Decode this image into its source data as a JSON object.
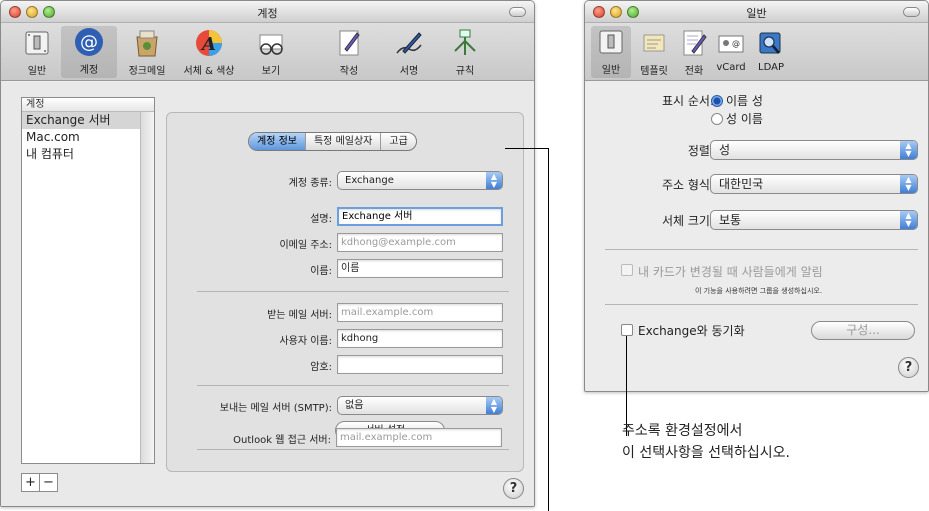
{
  "mail_window": {
    "title": "계정",
    "toolbar": [
      {
        "label": "일반",
        "icon": "switch-icon"
      },
      {
        "label": "계정",
        "icon": "at-icon",
        "selected": true
      },
      {
        "label": "정크메일",
        "icon": "junk-bag-icon"
      },
      {
        "label": "서체 & 색상",
        "icon": "font-color-icon"
      },
      {
        "label": "보기",
        "icon": "glasses-icon"
      },
      {
        "label": "작성",
        "icon": "compose-icon"
      },
      {
        "label": "서명",
        "icon": "signature-pen-icon"
      },
      {
        "label": "규칙",
        "icon": "rules-icon"
      }
    ],
    "accounts_header": "계정",
    "accounts": [
      "Exchange 서버",
      "Mac.com",
      "내 컴퓨터"
    ],
    "tabs": [
      "계정 정보",
      "특정 메일상자",
      "고급"
    ],
    "account_type_label": "계정 종류:",
    "account_type_value": "Exchange",
    "description_label": "설명:",
    "description_value": "Exchange 서버",
    "email_label": "이메일 주소:",
    "email_placeholder": "kdhong@example.com",
    "name_label": "이름:",
    "name_value": "이름",
    "incoming_label": "받는 메일 서버:",
    "incoming_placeholder": "mail.example.com",
    "username_label": "사용자 이름:",
    "username_value": "kdhong",
    "password_label": "암호:",
    "password_value": "",
    "smtp_label": "보내는 메일 서버 (SMTP):",
    "smtp_value": "없음",
    "server_settings_button": "서버 설정...",
    "owa_label": "Outlook 웹 접근 서버:",
    "owa_placeholder": "mail.example.com",
    "plus": "+",
    "minus": "−",
    "help": "?"
  },
  "addressbook_window": {
    "title": "일반",
    "toolbar": [
      {
        "label": "일반",
        "icon": "switch-icon",
        "selected": true
      },
      {
        "label": "템플릿",
        "icon": "template-icon"
      },
      {
        "label": "전화",
        "icon": "phone-note-icon"
      },
      {
        "label": "vCard",
        "icon": "vcard-icon"
      },
      {
        "label": "LDAP",
        "icon": "ldap-icon"
      }
    ],
    "show_order_label": "표시 순서:",
    "show_order_options": [
      "이름 성",
      "성 이름"
    ],
    "sort_label": "정렬:",
    "sort_value": "성",
    "address_format_label": "주소 형식:",
    "address_format_value": "대한민국",
    "font_size_label": "서체 크기:",
    "font_size_value": "보통",
    "notify_checkbox": "내 카드가 변경될 때 사람들에게 알림",
    "notify_note": "이 기능을 사용하려면 그룹을 생성하십시오.",
    "sync_checkbox": "Exchange와 동기화",
    "configure_button": "구성...",
    "help": "?"
  },
  "callout": {
    "line1": "주소록 환경설정에서",
    "line2": "이 선택사항을 선택하십시오."
  }
}
